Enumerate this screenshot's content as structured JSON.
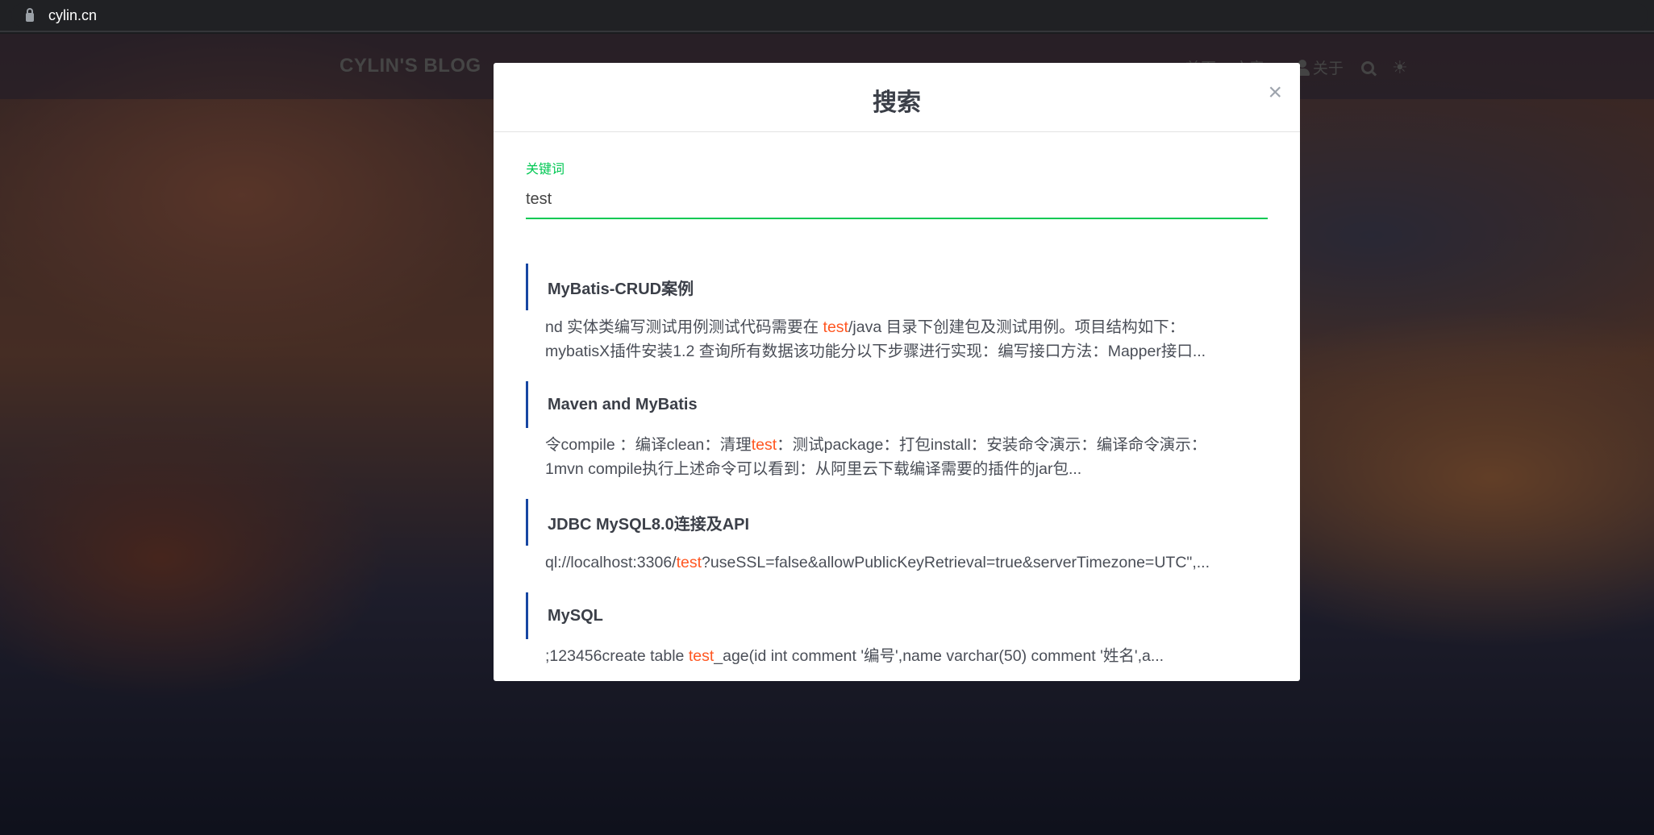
{
  "browser": {
    "url": "cylin.cn"
  },
  "navbar": {
    "brand": "CYLIN'S BLOG",
    "items": [
      {
        "label": "首页"
      },
      {
        "label": "文章"
      },
      {
        "label": "关于"
      }
    ]
  },
  "modal": {
    "title": "搜索",
    "close_label": "×",
    "field_label": "关键词",
    "query": "test",
    "results": [
      {
        "title": "MyBatis-CRUD案例",
        "before": "nd 实体类编写测试用例测试代码需要在 ",
        "match": "test",
        "after": "/java 目录下创建包及测试用例。项目结构如下：\nmybatisX插件安装1.2 查询所有数据该功能分以下步骤进行实现：编写接口方法：Mapper接口..."
      },
      {
        "title": "Maven and MyBatis",
        "before": "令compile ：编译clean：清理",
        "match": "test",
        "after": "：测试package：打包install：安装命令演示：编译命令演示：\n1mvn compile执行上述命令可以看到：从阿里云下载编译需要的插件的jar包..."
      },
      {
        "title": "JDBC MySQL8.0连接及API",
        "before": "ql://localhost:3306/",
        "match": "test",
        "after": "?useSSL=false&allowPublicKeyRetrieval=true&serverTimezone=UTC\",..."
      },
      {
        "title": "MySQL",
        "before": ";123456create table ",
        "match": "test",
        "after": "_age(id int comment '编号',name varchar(50) comment '姓名',a..."
      }
    ]
  }
}
